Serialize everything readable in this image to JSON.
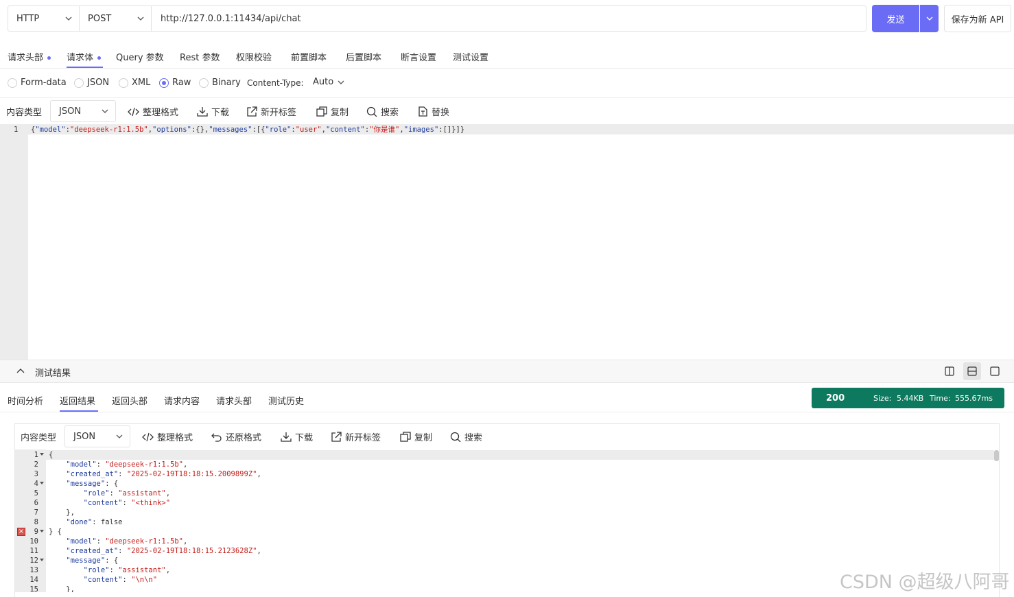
{
  "request": {
    "protocol": "HTTP",
    "method": "POST",
    "url": "http://127.0.0.1:11434/api/chat",
    "send_label": "发送",
    "save_label": "保存为新 API"
  },
  "req_tabs": [
    {
      "label": "请求头部",
      "dot": true
    },
    {
      "label": "请求体",
      "dot": true,
      "active": true
    },
    {
      "label": "Query 参数"
    },
    {
      "label": "Rest 参数"
    },
    {
      "label": "权限校验"
    },
    {
      "label": "前置脚本"
    },
    {
      "label": "后置脚本"
    },
    {
      "label": "断言设置"
    },
    {
      "label": "测试设置"
    }
  ],
  "body_types": [
    {
      "label": "Form-data",
      "selected": false
    },
    {
      "label": "JSON",
      "selected": false
    },
    {
      "label": "XML",
      "selected": false
    },
    {
      "label": "Raw",
      "selected": true
    },
    {
      "label": "Binary",
      "selected": false
    }
  ],
  "content_type_label": "Content-Type:",
  "content_type_value": "Auto",
  "editor_toolbar": {
    "content_type_label": "内容类型",
    "content_type_value": "JSON",
    "format": "整理格式",
    "download": "下载",
    "new_tab": "新开标签",
    "copy": "复制",
    "search": "搜索",
    "replace": "替换"
  },
  "request_body": {
    "line_no": "1",
    "segments": [
      {
        "t": "{",
        "c": "p"
      },
      {
        "t": "\"model\"",
        "c": "key"
      },
      {
        "t": ":",
        "c": "p"
      },
      {
        "t": "\"deepseek-r1:1.5b\"",
        "c": "str"
      },
      {
        "t": ",",
        "c": "p"
      },
      {
        "t": "\"options\"",
        "c": "key"
      },
      {
        "t": ":{},",
        "c": "p"
      },
      {
        "t": "\"messages\"",
        "c": "key"
      },
      {
        "t": ":[{",
        "c": "p"
      },
      {
        "t": "\"role\"",
        "c": "key"
      },
      {
        "t": ":",
        "c": "p"
      },
      {
        "t": "\"user\"",
        "c": "str"
      },
      {
        "t": ",",
        "c": "p"
      },
      {
        "t": "\"content\"",
        "c": "key"
      },
      {
        "t": ":",
        "c": "p"
      },
      {
        "t": "\"你是谁\"",
        "c": "str"
      },
      {
        "t": ",",
        "c": "p"
      },
      {
        "t": "\"images\"",
        "c": "key"
      },
      {
        "t": ":[]}]}",
        "c": "p"
      }
    ]
  },
  "results": {
    "title": "测试结果",
    "tabs": [
      "时间分析",
      "返回结果",
      "返回头部",
      "请求内容",
      "请求头部",
      "测试历史"
    ],
    "active_tab": 1,
    "status": "200",
    "size_label": "Size:",
    "size_value": "5.44KB",
    "time_label": "Time:",
    "time_value": "555.67ms",
    "toolbar": {
      "content_type_label": "内容类型",
      "content_type_value": "JSON",
      "format": "整理格式",
      "restore": "还原格式",
      "download": "下载",
      "new_tab": "新开标签",
      "copy": "复制",
      "search": "搜索"
    },
    "lines": [
      {
        "n": "1",
        "fold": true,
        "parts": [
          {
            "t": "{",
            "c": "p"
          }
        ]
      },
      {
        "n": "2",
        "parts": [
          {
            "t": "    ",
            "c": "p"
          },
          {
            "t": "\"model\"",
            "c": "key"
          },
          {
            "t": ": ",
            "c": "p"
          },
          {
            "t": "\"deepseek-r1:1.5b\"",
            "c": "str"
          },
          {
            "t": ",",
            "c": "p"
          }
        ]
      },
      {
        "n": "3",
        "parts": [
          {
            "t": "    ",
            "c": "p"
          },
          {
            "t": "\"created_at\"",
            "c": "key"
          },
          {
            "t": ": ",
            "c": "p"
          },
          {
            "t": "\"2025-02-19T18:18:15.2009899Z\"",
            "c": "str"
          },
          {
            "t": ",",
            "c": "p"
          }
        ]
      },
      {
        "n": "4",
        "fold": true,
        "parts": [
          {
            "t": "    ",
            "c": "p"
          },
          {
            "t": "\"message\"",
            "c": "key"
          },
          {
            "t": ": {",
            "c": "p"
          }
        ]
      },
      {
        "n": "5",
        "parts": [
          {
            "t": "        ",
            "c": "p"
          },
          {
            "t": "\"role\"",
            "c": "key"
          },
          {
            "t": ": ",
            "c": "p"
          },
          {
            "t": "\"assistant\"",
            "c": "str"
          },
          {
            "t": ",",
            "c": "p"
          }
        ]
      },
      {
        "n": "6",
        "parts": [
          {
            "t": "        ",
            "c": "p"
          },
          {
            "t": "\"content\"",
            "c": "key"
          },
          {
            "t": ": ",
            "c": "p"
          },
          {
            "t": "\"<think>\"",
            "c": "str"
          }
        ]
      },
      {
        "n": "7",
        "parts": [
          {
            "t": "    },",
            "c": "p"
          }
        ]
      },
      {
        "n": "8",
        "parts": [
          {
            "t": "    ",
            "c": "p"
          },
          {
            "t": "\"done\"",
            "c": "key"
          },
          {
            "t": ": false",
            "c": "p"
          }
        ]
      },
      {
        "n": "9",
        "fold": true,
        "error": true,
        "parts": [
          {
            "t": "} {",
            "c": "p"
          }
        ]
      },
      {
        "n": "10",
        "parts": [
          {
            "t": "    ",
            "c": "p"
          },
          {
            "t": "\"model\"",
            "c": "key"
          },
          {
            "t": ": ",
            "c": "p"
          },
          {
            "t": "\"deepseek-r1:1.5b\"",
            "c": "str"
          },
          {
            "t": ",",
            "c": "p"
          }
        ]
      },
      {
        "n": "11",
        "parts": [
          {
            "t": "    ",
            "c": "p"
          },
          {
            "t": "\"created_at\"",
            "c": "key"
          },
          {
            "t": ": ",
            "c": "p"
          },
          {
            "t": "\"2025-02-19T18:18:15.2123628Z\"",
            "c": "str"
          },
          {
            "t": ",",
            "c": "p"
          }
        ]
      },
      {
        "n": "12",
        "fold": true,
        "parts": [
          {
            "t": "    ",
            "c": "p"
          },
          {
            "t": "\"message\"",
            "c": "key"
          },
          {
            "t": ": {",
            "c": "p"
          }
        ]
      },
      {
        "n": "13",
        "parts": [
          {
            "t": "        ",
            "c": "p"
          },
          {
            "t": "\"role\"",
            "c": "key"
          },
          {
            "t": ": ",
            "c": "p"
          },
          {
            "t": "\"assistant\"",
            "c": "str"
          },
          {
            "t": ",",
            "c": "p"
          }
        ]
      },
      {
        "n": "14",
        "parts": [
          {
            "t": "        ",
            "c": "p"
          },
          {
            "t": "\"content\"",
            "c": "key"
          },
          {
            "t": ": ",
            "c": "p"
          },
          {
            "t": "\"\\n\\n\"",
            "c": "str"
          }
        ]
      },
      {
        "n": "15",
        "parts": [
          {
            "t": "    },",
            "c": "p"
          }
        ]
      }
    ]
  },
  "watermark": "CSDN @超级八阿哥",
  "colors": {
    "accent": "#6b6cf6",
    "status": "#0d7a5f"
  }
}
